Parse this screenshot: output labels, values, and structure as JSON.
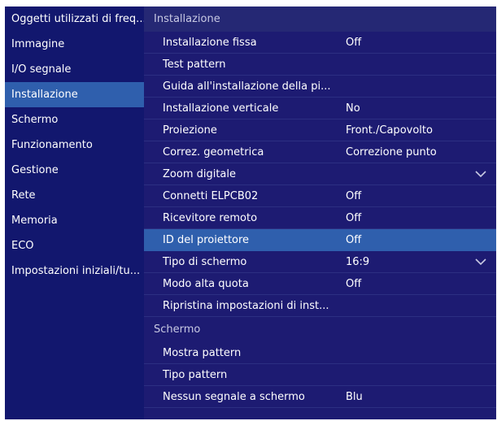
{
  "sidebar": {
    "items": [
      {
        "label": "Oggetti utilizzati di freq...",
        "active": false
      },
      {
        "label": "Immagine",
        "active": false
      },
      {
        "label": "I/O segnale",
        "active": false
      },
      {
        "label": "Installazione",
        "active": true
      },
      {
        "label": "Schermo",
        "active": false
      },
      {
        "label": "Funzionamento",
        "active": false
      },
      {
        "label": "Gestione",
        "active": false
      },
      {
        "label": "Rete",
        "active": false
      },
      {
        "label": "Memoria",
        "active": false
      },
      {
        "label": "ECO",
        "active": false
      },
      {
        "label": "Impostazioni iniziali/tu...",
        "active": false
      }
    ]
  },
  "sections": [
    {
      "title": "Installazione",
      "rows": [
        {
          "label": "Installazione fissa",
          "value": "Off"
        },
        {
          "label": "Test pattern",
          "value": ""
        },
        {
          "label": "Guida all'installazione della pi...",
          "value": ""
        },
        {
          "label": "Installazione verticale",
          "value": "No"
        },
        {
          "label": "Proiezione",
          "value": "Front./Capovolto"
        },
        {
          "label": "Correz. geometrica",
          "value": "Correzione punto"
        },
        {
          "label": "Zoom digitale",
          "value": "",
          "dropdown": true
        },
        {
          "label": "Connetti ELPCB02",
          "value": "Off"
        },
        {
          "label": "Ricevitore remoto",
          "value": "Off"
        },
        {
          "label": "ID del proiettore",
          "value": "Off",
          "active": true
        },
        {
          "label": "Tipo di schermo",
          "value": "16:9",
          "dropdown": true
        },
        {
          "label": "Modo alta quota",
          "value": "Off"
        },
        {
          "label": "Ripristina impostazioni di inst...",
          "value": ""
        }
      ]
    },
    {
      "title": "Schermo",
      "rows": [
        {
          "label": "Mostra pattern",
          "value": ""
        },
        {
          "label": "Tipo pattern",
          "value": ""
        },
        {
          "label": "Nessun segnale a schermo",
          "value": "Blu"
        }
      ]
    }
  ],
  "colors": {
    "sidebar_bg": "#12176e",
    "main_bg": "#1d1b72",
    "highlight": "#2f5fad"
  },
  "icons": {
    "dropdown": "chevron-down-icon"
  }
}
